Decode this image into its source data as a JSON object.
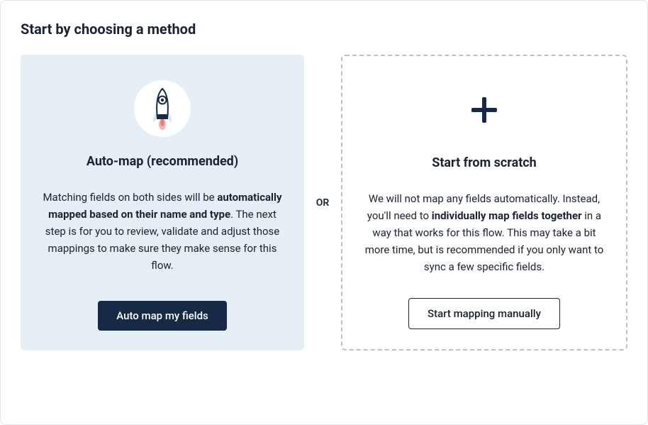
{
  "title": "Start by choosing a method",
  "divider_label": "OR",
  "auto": {
    "title": "Auto-map (recommended)",
    "desc_pre": "Matching fields on both sides will be ",
    "desc_bold": "automatically mapped based on their name and type",
    "desc_post": ". The next step is for you to review, validate and adjust those mappings to make sure they make sense for this flow.",
    "button_label": "Auto map my fields"
  },
  "manual": {
    "title": "Start from scratch",
    "desc_pre": "We will not map any fields automatically. Instead, you'll need to ",
    "desc_bold": "individually map fields together",
    "desc_post": " in a way that works for this flow. This may take a bit more time, but is recommended if you only want to sync a few specific fields.",
    "button_label": "Start mapping manually"
  }
}
